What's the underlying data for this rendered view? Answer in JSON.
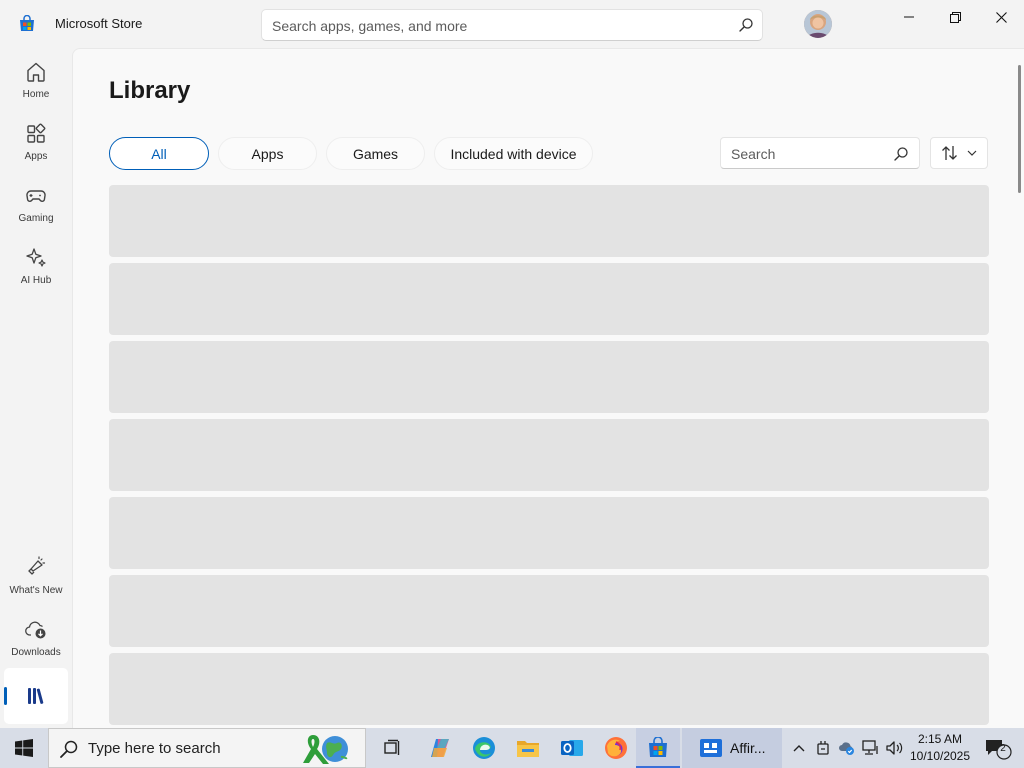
{
  "window": {
    "title": "Microsoft Store"
  },
  "header": {
    "search_placeholder": "Search apps, games, and more"
  },
  "sidebar": {
    "items": [
      {
        "label": "Home",
        "icon": "home-icon"
      },
      {
        "label": "Apps",
        "icon": "apps-icon"
      },
      {
        "label": "Gaming",
        "icon": "gamepad-icon"
      },
      {
        "label": "AI Hub",
        "icon": "sparkle-icon"
      },
      {
        "label": "What's New",
        "icon": "megaphone-icon"
      },
      {
        "label": "Downloads",
        "icon": "cloud-download-icon"
      },
      {
        "label": "",
        "icon": "library-icon",
        "active": true
      }
    ]
  },
  "main": {
    "title": "Library",
    "filters": [
      "All",
      "Apps",
      "Games",
      "Included with device"
    ],
    "selected_filter": "All",
    "search_placeholder": "Search",
    "loading_rows": 7
  },
  "taskbar": {
    "search_text": "Type here to search",
    "pinned": [
      "task-view-icon",
      "copilot-icon",
      "edge-icon",
      "file-explorer-icon",
      "outlook-icon",
      "firefox-icon",
      "store-icon"
    ],
    "open_app_label": "Affir...",
    "clock": {
      "time": "2:15 AM",
      "date": "10/10/2025"
    },
    "notification_count": "2"
  },
  "colors": {
    "accent": "#005fb8",
    "skeleton": "#e3e3e3",
    "taskbar": "#d8dde7"
  }
}
